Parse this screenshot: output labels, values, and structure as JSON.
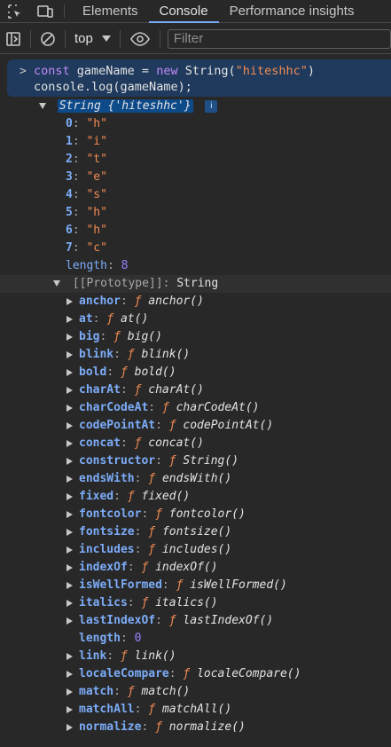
{
  "tabs": [
    {
      "label": "Elements"
    },
    {
      "label": "Console"
    },
    {
      "label": "Performance insights"
    }
  ],
  "toolbar": {
    "context": "top",
    "filter_placeholder": "Filter"
  },
  "input": {
    "line1": {
      "kw1": "const",
      "name": " gameName = ",
      "kw2": "new",
      "cls": " String(",
      "str": "\"hiteshhc\"",
      "end": ")"
    },
    "line2": {
      "obj": "console.",
      "method": "log",
      "args": "(gameName);"
    }
  },
  "output": {
    "header": "String {'hiteshhc'}",
    "info": "i",
    "entries": [
      {
        "key": "0",
        "value": "\"h\""
      },
      {
        "key": "1",
        "value": "\"i\""
      },
      {
        "key": "2",
        "value": "\"t\""
      },
      {
        "key": "3",
        "value": "\"e\""
      },
      {
        "key": "4",
        "value": "\"s\""
      },
      {
        "key": "5",
        "value": "\"h\""
      },
      {
        "key": "6",
        "value": "\"h\""
      },
      {
        "key": "7",
        "value": "\"c\""
      }
    ],
    "length_key": "length",
    "length_val": "8",
    "prototype_label": "[[Prototype]]",
    "prototype_value": "String",
    "proto_items": [
      {
        "key": "anchor",
        "fn": "anchor()",
        "expandable": true
      },
      {
        "key": "at",
        "fn": "at()",
        "expandable": true
      },
      {
        "key": "big",
        "fn": "big()",
        "expandable": true
      },
      {
        "key": "blink",
        "fn": "blink()",
        "expandable": true
      },
      {
        "key": "bold",
        "fn": "bold()",
        "expandable": true
      },
      {
        "key": "charAt",
        "fn": "charAt()",
        "expandable": true
      },
      {
        "key": "charCodeAt",
        "fn": "charCodeAt()",
        "expandable": true
      },
      {
        "key": "codePointAt",
        "fn": "codePointAt()",
        "expandable": true
      },
      {
        "key": "concat",
        "fn": "concat()",
        "expandable": true
      },
      {
        "key": "constructor",
        "fn": "String()",
        "expandable": true
      },
      {
        "key": "endsWith",
        "fn": "endsWith()",
        "expandable": true
      },
      {
        "key": "fixed",
        "fn": "fixed()",
        "expandable": true
      },
      {
        "key": "fontcolor",
        "fn": "fontcolor()",
        "expandable": true
      },
      {
        "key": "fontsize",
        "fn": "fontsize()",
        "expandable": true
      },
      {
        "key": "includes",
        "fn": "includes()",
        "expandable": true
      },
      {
        "key": "indexOf",
        "fn": "indexOf()",
        "expandable": true
      },
      {
        "key": "isWellFormed",
        "fn": "isWellFormed()",
        "expandable": true
      },
      {
        "key": "italics",
        "fn": "italics()",
        "expandable": true
      },
      {
        "key": "lastIndexOf",
        "fn": "lastIndexOf()",
        "expandable": true
      },
      {
        "key": "length",
        "num": "0",
        "expandable": false
      },
      {
        "key": "link",
        "fn": "link()",
        "expandable": true
      },
      {
        "key": "localeCompare",
        "fn": "localeCompare()",
        "expandable": true
      },
      {
        "key": "match",
        "fn": "match()",
        "expandable": true
      },
      {
        "key": "matchAll",
        "fn": "matchAll()",
        "expandable": true
      },
      {
        "key": "normalize",
        "fn": "normalize()",
        "expandable": true
      }
    ],
    "f_symbol": "ƒ"
  }
}
